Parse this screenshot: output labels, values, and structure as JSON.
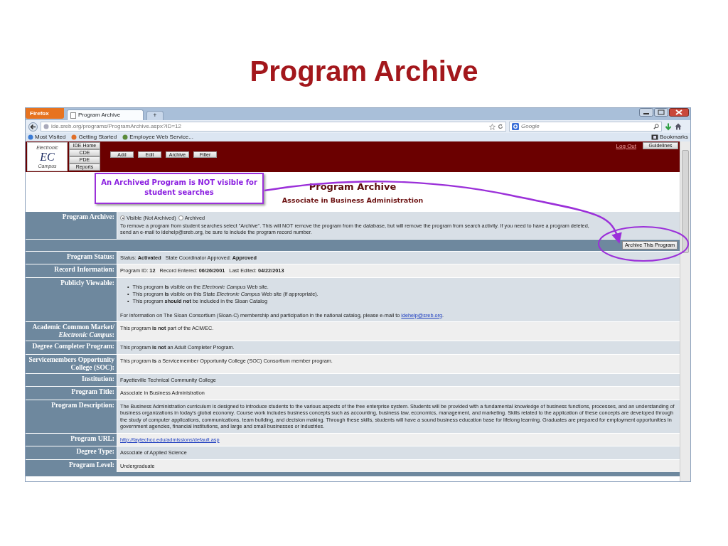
{
  "slide_title": "Program Archive",
  "browser": {
    "menu_button": "Firefox",
    "tab": {
      "label": "Program Archive",
      "selected": true
    },
    "new_tab": "+",
    "address": "ide.sreb.org/programs/ProgramArchive.aspx?ID=12",
    "search_placeholder": "Google",
    "bookmarks": [
      "Most Visited",
      "Getting Started",
      "Employee Web Service..."
    ],
    "bookmarks_menu": "Bookmarks"
  },
  "header": {
    "logo": {
      "top": "Electronic",
      "letters": "EC",
      "bottom": "Campus"
    },
    "nav_buttons": [
      "IDE Home",
      "CDE",
      "PDE",
      "Reports"
    ],
    "actions": [
      "Add",
      "Edit",
      "Archive",
      "Filter"
    ],
    "logout": "Log Out",
    "guidelines": "Guidelines"
  },
  "callout": "An Archived Program is NOT visible for student searches",
  "heading": "Program Archive",
  "subheading": "Associate in Business Administration",
  "archive": {
    "label": "Program Archive:",
    "options": [
      {
        "label": "Visible (Not Archived)",
        "selected": true
      },
      {
        "label": "Archived",
        "selected": false
      }
    ],
    "note": "To remove a program from student searches select \"Archive\". This will NOT remove the program from the database, but will remove the program from search activity. If you need to have a program deleted, send an e-mail to idehelp@sreb.org, be sure to include the program record number.",
    "button": "Archive This Program"
  },
  "rows": [
    {
      "kind": "text",
      "label": "Program Status:",
      "value": "Status: **Activated**   State Coordinator Approved: **Approved**"
    },
    {
      "kind": "text",
      "label": "Record Information:",
      "value": "Program ID: **12**   Record Entered: **06/26/2001**   Last Edited: **04/22/2013**"
    },
    {
      "kind": "list",
      "label": "Publicly Viewable:",
      "bullet": "•",
      "items": [
        "This program **is** visible on the *Electronic Campus* Web site.",
        "This program **is** visible on this State *Electronic Campus* Web site (if appropriate).",
        "This program **should not** be included in the Sloan Catalog"
      ],
      "note": "For information on The Sloan Consortium (Sloan-C) membership and participation in the national catalog, please e-mail to",
      "link": "idehelp@sreb.org",
      "note_end": "."
    },
    {
      "kind": "text",
      "label": "Academic Common Market/ *Electronic Campus*:",
      "value": "This program **is not** part of the ACM/EC."
    },
    {
      "kind": "text",
      "label": "Degree Completer Program:",
      "value": "This program **is not** an Adult Completer Program."
    },
    {
      "kind": "text",
      "label": "Servicemembers Opportunity College (SOC):",
      "value": "This program **is** a Servicemember Opportunity College (SOC) Consortium member program."
    },
    {
      "kind": "text",
      "label": "Institution:",
      "value": "Fayetteville Technical Community College"
    },
    {
      "kind": "text",
      "label": "Program Title:",
      "value": "Associate in Business Administration"
    },
    {
      "kind": "text",
      "label": "Program Description:",
      "value": "The Business Administration curriculum is designed to introduce students to the various aspects of the free enterprise system. Students will be provided with a fundamental knowledge of business functions, processes, and an understanding of business organizations in today's global economy. Course work includes business concepts such as accounting, business law, economics, management, and marketing. Skills related to the application of these concepts are developed through the study of computer applications, communications, team building, and decision making. Through these skills, students will have a sound business education base for lifelong learning. Graduates are prepared for employment opportunities in government agencies, financial institutions, and large and small businesses or industries."
    },
    {
      "kind": "link",
      "label": "Program URL:",
      "value": "http://faytechcc.edu/admissions/default.asp"
    },
    {
      "kind": "text",
      "label": "Degree Type:",
      "value": "Associate of Applied Science"
    },
    {
      "kind": "text",
      "label": "Program Level:",
      "value": "Undergraduate"
    }
  ]
}
